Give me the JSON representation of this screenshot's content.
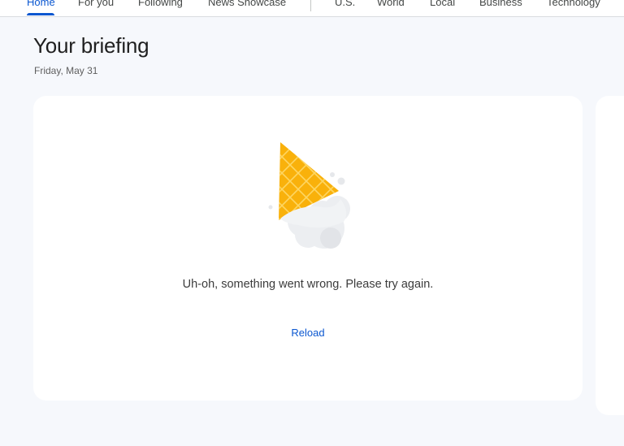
{
  "nav": {
    "tabs": [
      {
        "label": "Home",
        "active": true
      },
      {
        "label": "For you",
        "active": false
      },
      {
        "label": "Following",
        "active": false
      },
      {
        "label": "News Showcase",
        "active": false
      },
      {
        "label": "U.S.",
        "active": false
      },
      {
        "label": "World",
        "active": false
      },
      {
        "label": "Local",
        "active": false
      },
      {
        "label": "Business",
        "active": false
      },
      {
        "label": "Technology",
        "active": false
      }
    ]
  },
  "header": {
    "title": "Your briefing",
    "date": "Friday, May 31"
  },
  "error": {
    "message": "Uh-oh, something went wrong. Please try again.",
    "reload_label": "Reload",
    "illustration": "melted-ice-cream-cone"
  },
  "colors": {
    "accent": "#0b57d0",
    "background": "#f6f8fc",
    "cone": "#f9b10b",
    "cream": "#eceef1"
  }
}
